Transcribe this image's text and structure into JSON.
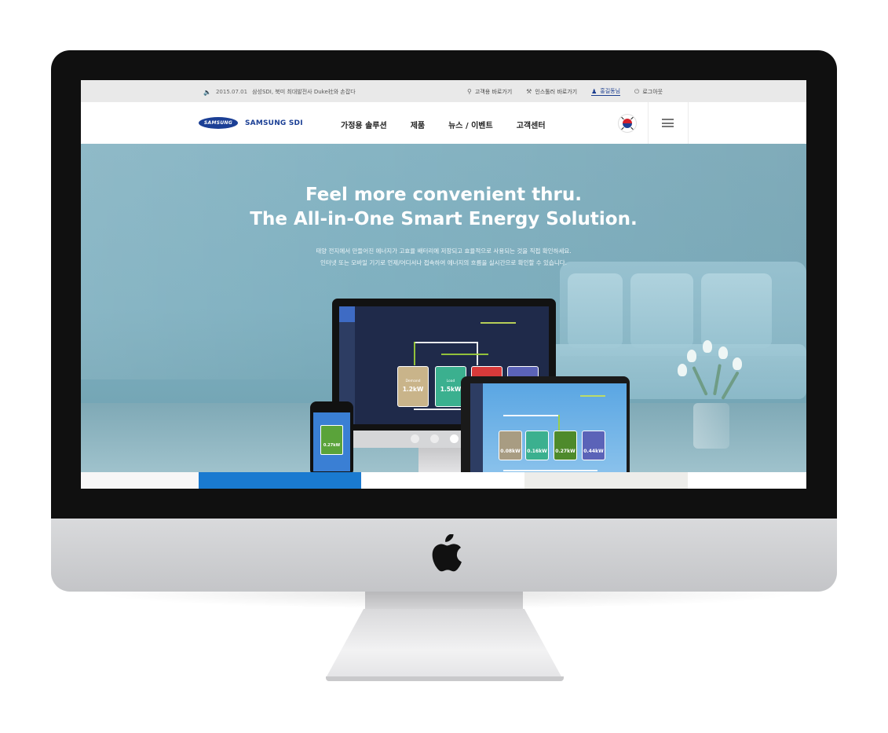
{
  "utility": {
    "speaker_icon": "speaker-icon",
    "news_date": "2015.07.01",
    "news_text": "삼성SDI, 북미 최대발전사 Duke社와 손잡다",
    "links": [
      {
        "label": "고객용 바로가기",
        "icon": "lock-icon"
      },
      {
        "label": "인스톨러 바로가기",
        "icon": "wrench-icon"
      },
      {
        "label": "홍길동님",
        "icon": "user-icon"
      },
      {
        "label": "로그아웃",
        "icon": "power-icon"
      }
    ]
  },
  "nav": {
    "logo_mark": "SAMSUNG",
    "logo_text": "SAMSUNG SDI",
    "menu": [
      "가정용 솔루션",
      "제품",
      "뉴스 / 이벤트",
      "고객센터"
    ],
    "language_flag": "korea-flag-icon",
    "menu_icon": "hamburger-icon"
  },
  "hero": {
    "title_line1": "Feel more convenient thru.",
    "title_line2": "The All-in-One Smart Energy Solution.",
    "subtitle_line1": "태양 전지에서 만들어진 에너지가 고효율 배터리에 저장되고 효율적으로 사용되는 것을 직접 확인하세요.",
    "subtitle_line2": "인터넷 또는 모바일 기기로 언제/어디서나 접속하여 에너지의 흐름을 실시간으로 확인할 수 있습니다.",
    "monitor_tiles": [
      {
        "label": "Demand",
        "value": "1.2kW",
        "color": "#c9b48a"
      },
      {
        "label": "Load",
        "value": "1.5kW",
        "color": "#3bb08f"
      },
      {
        "label": "",
        "value": "",
        "color": "#d83a3a"
      },
      {
        "label": "",
        "value": "",
        "color": "#5b63b8"
      }
    ],
    "tablet_tiles": [
      {
        "label": "Demand",
        "value": "0.08kW",
        "color": "#a89c82"
      },
      {
        "label": "Load",
        "value": "0.16kW",
        "color": "#3bb08f"
      },
      {
        "label": "",
        "value": "0.27kW",
        "color": "#4e8a2b"
      },
      {
        "label": "",
        "value": "0.44kW",
        "color": "#5b63b8"
      }
    ],
    "phone_value": "0.27kW",
    "slides_total": 4,
    "slide_active": 3
  },
  "colors": {
    "brand_blue": "#1b3f95",
    "accent_blue": "#1a7ad0",
    "hero_bg": "#7fb0c0"
  }
}
